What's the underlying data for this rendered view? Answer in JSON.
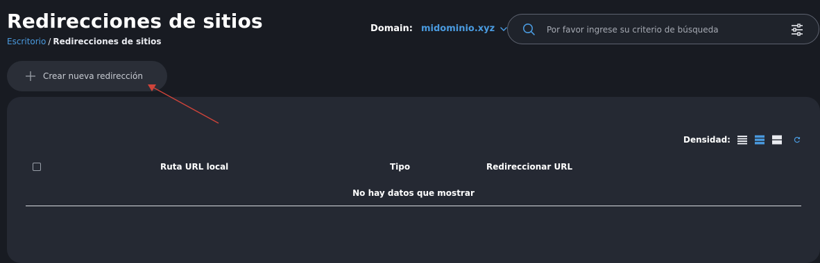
{
  "header": {
    "title": "Redirecciones de sitios",
    "breadcrumb": {
      "home": "Escritorio",
      "separator": "/",
      "current": "Redirecciones de sitios"
    }
  },
  "domain": {
    "label": "Domain:",
    "value": "midominio.xyz",
    "icon": "chevron-down-icon"
  },
  "search": {
    "placeholder": "Por favor ingrese su criterio de búsqueda",
    "value": "",
    "icons": [
      "search-icon",
      "filter-sliders-icon"
    ]
  },
  "actions": {
    "create_label": "Crear nueva redirección",
    "create_icon": "plus-icon"
  },
  "table": {
    "density_label": "Densidad:",
    "density_options": [
      "compact",
      "default",
      "comfortable"
    ],
    "density_selected": "default",
    "columns": [
      "Ruta URL local",
      "Tipo",
      "Redireccionar URL"
    ],
    "rows": [],
    "empty_text": "No hay datos que mostrar"
  },
  "colors": {
    "background": "#181b22",
    "card": "#252933",
    "accent": "#4a9be0",
    "annotation_arrow": "#d0443a"
  }
}
